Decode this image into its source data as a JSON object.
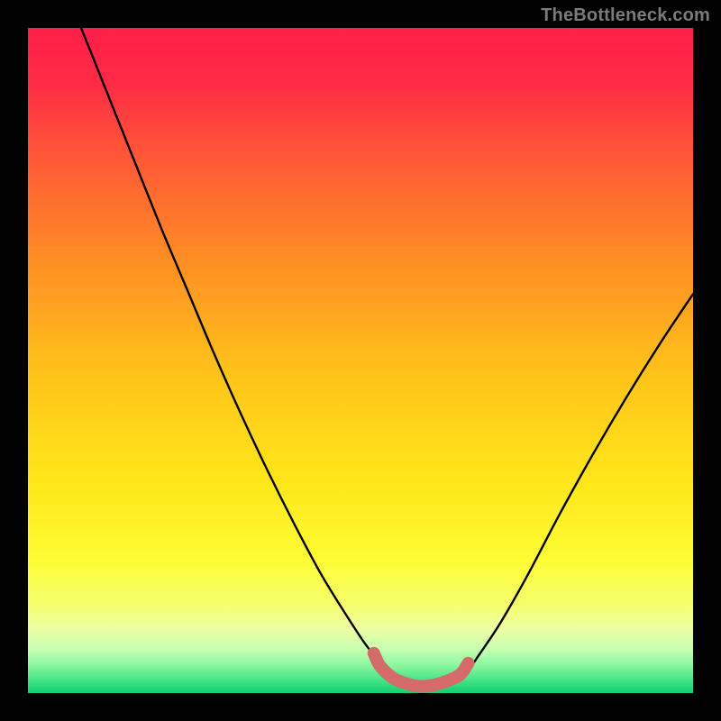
{
  "watermark": "TheBottleneck.com",
  "chart_data": {
    "type": "line",
    "title": "",
    "xlabel": "",
    "ylabel": "",
    "xlim": [
      0,
      100
    ],
    "ylim": [
      0,
      100
    ],
    "gradient_stops": [
      {
        "offset": 0.0,
        "color": "#ff1f49"
      },
      {
        "offset": 0.08,
        "color": "#ff2a45"
      },
      {
        "offset": 0.2,
        "color": "#ff5a36"
      },
      {
        "offset": 0.35,
        "color": "#ff8e24"
      },
      {
        "offset": 0.52,
        "color": "#ffc31a"
      },
      {
        "offset": 0.68,
        "color": "#ffe61a"
      },
      {
        "offset": 0.8,
        "color": "#fdfd33"
      },
      {
        "offset": 0.87,
        "color": "#f5ff70"
      },
      {
        "offset": 0.905,
        "color": "#ecffa6"
      },
      {
        "offset": 0.935,
        "color": "#c5ffb0"
      },
      {
        "offset": 0.958,
        "color": "#8cf7a0"
      },
      {
        "offset": 0.978,
        "color": "#4fe68a"
      },
      {
        "offset": 0.993,
        "color": "#1fd879"
      },
      {
        "offset": 1.0,
        "color": "#15d074"
      }
    ],
    "series": [
      {
        "name": "bottleneck-curve",
        "color": "#000000",
        "x": [
          8,
          12,
          16,
          20,
          24,
          28,
          32,
          36,
          40,
          44,
          48,
          51,
          54,
          56.5,
          58.5,
          60,
          62,
          64,
          66,
          68,
          71,
          75,
          80,
          85,
          90,
          95,
          100
        ],
        "y": [
          100,
          90,
          80,
          70,
          60.5,
          51,
          42,
          33.5,
          25.5,
          18,
          11.5,
          7,
          3.5,
          1.5,
          0.7,
          0.5,
          0.7,
          1.5,
          3.2,
          6,
          10.5,
          17.5,
          27,
          36,
          44.5,
          52.5,
          60
        ]
      },
      {
        "name": "optimal-flat-zone",
        "color": "#d46a6a",
        "x": [
          52,
          53,
          55,
          57,
          59,
          61,
          63,
          65,
          66.2
        ],
        "y": [
          6.0,
          4.0,
          2.2,
          1.4,
          1.0,
          1.2,
          1.8,
          2.8,
          4.5
        ]
      }
    ],
    "annotations": []
  }
}
